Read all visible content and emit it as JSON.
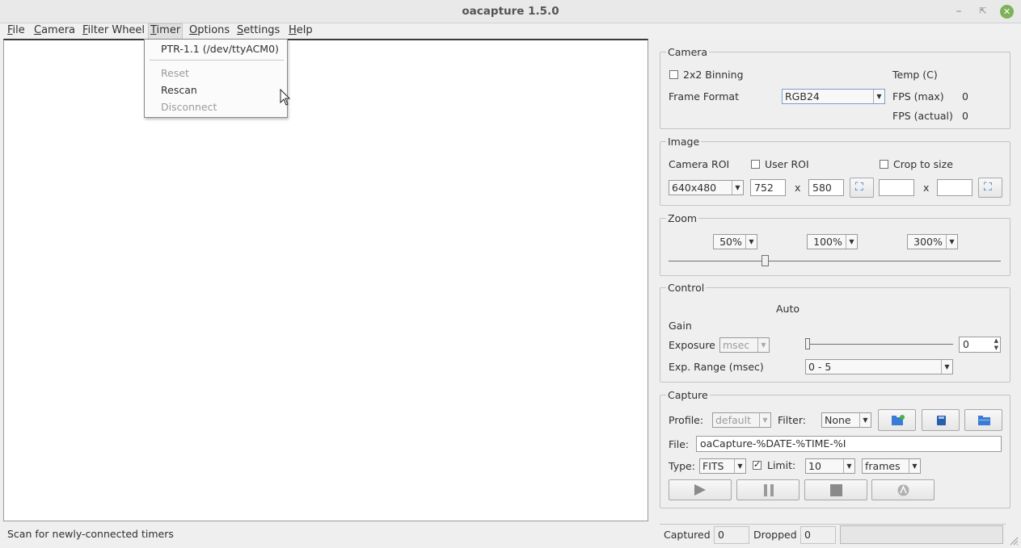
{
  "window": {
    "title": "oacapture 1.5.0"
  },
  "menu": [
    {
      "label": "File",
      "key": "F",
      "rest": "ile"
    },
    {
      "label": "Camera",
      "key": "C",
      "rest": "amera"
    },
    {
      "label": "Filter Wheel",
      "key": "F",
      "rest": "ilter Wheel"
    },
    {
      "label": "Timer",
      "key": "T",
      "rest": "imer"
    },
    {
      "label": "Options",
      "key": "O",
      "rest": "ptions"
    },
    {
      "label": "Settings",
      "key": "S",
      "rest": "ettings"
    },
    {
      "label": "Help",
      "key": "H",
      "rest": "elp"
    }
  ],
  "timer_menu": {
    "device": "PTR-1.1 (/dev/ttyACM0)",
    "reset": "Reset",
    "rescan": "Rescan",
    "disconnect": "Disconnect"
  },
  "status_text": "Scan for newly-connected timers",
  "camera": {
    "title": "Camera",
    "binning_label": "2x2 Binning",
    "binning_checked": false,
    "temp_label": "Temp (C)",
    "frame_format_label": "Frame Format",
    "frame_format_value": "RGB24",
    "fps_max_label": "FPS (max)",
    "fps_max_value": "0",
    "fps_actual_label": "FPS (actual)",
    "fps_actual_value": "0"
  },
  "image": {
    "title": "Image",
    "camera_roi_label": "Camera ROI",
    "user_roi_label": "User ROI",
    "crop_label": "Crop to size",
    "roi_value": "640x480",
    "width": "752",
    "x_sep": "x",
    "height": "580",
    "crop_width": "",
    "crop_height": ""
  },
  "zoom": {
    "title": "Zoom",
    "z50": "50%",
    "z100": "100%",
    "z300": "300%",
    "slider_fraction": 0.28
  },
  "control": {
    "title": "Control",
    "auto_label": "Auto",
    "gain_label": "Gain",
    "exposure_label": "Exposure",
    "exposure_unit": "msec",
    "exposure_value": "0",
    "exposure_slider_fraction": 0.0,
    "exp_range_label": "Exp. Range (msec)",
    "exp_range_value": "0 - 5"
  },
  "capture": {
    "title": "Capture",
    "profile_label": "Profile:",
    "profile_value": "default",
    "filter_label": "Filter:",
    "filter_value": "None",
    "file_label": "File:",
    "file_value": "oaCapture-%DATE-%TIME-%I",
    "type_label": "Type:",
    "type_value": "FITS",
    "limit_label": "Limit:",
    "limit_checked": true,
    "limit_value": "10",
    "limit_unit": "frames"
  },
  "stats": {
    "captured_label": "Captured",
    "captured_value": "0",
    "dropped_label": "Dropped",
    "dropped_value": "0",
    "progress": 0.0
  }
}
